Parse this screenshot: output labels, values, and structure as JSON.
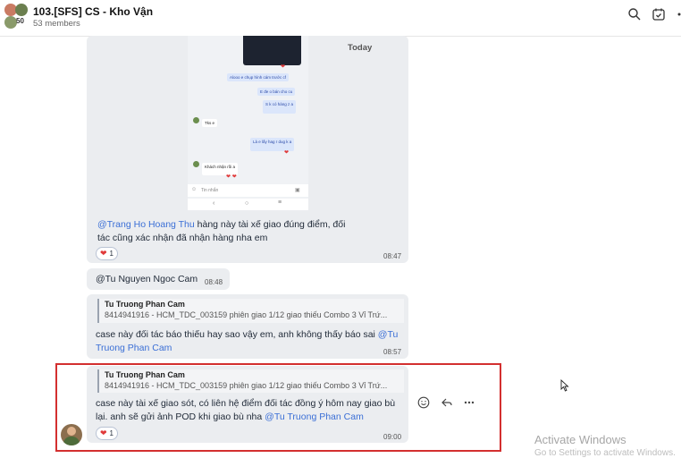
{
  "header": {
    "group_name": "103.[SFS] CS - Kho Vận",
    "member_count": "53 members",
    "avatar_count": "50"
  },
  "date_divider": "Today",
  "screenshot": {
    "messages_right": [
      "Alooo e chụp hình cám trước cf",
      "E đe o bán cho cu",
      "S k có hàng z a",
      "Là e lấy hag r dug k a"
    ],
    "messages_left": [
      "Tks e",
      "Khách nhận rồi a"
    ],
    "input_placeholder": "Tin nhắn"
  },
  "messages": [
    {
      "mention": "@Trang Ho Hoang Thu",
      "text_line1": " hàng này tài xế giao đúng điểm, đối",
      "text_line2": "tác cũng xác nhận đã nhận hàng nha em",
      "reaction_count": "1",
      "time": "08:47"
    },
    {
      "mention": "@Tu Nguyen Ngoc Cam",
      "time": "08:48"
    },
    {
      "quote_name": "Tu Truong Phan Cam",
      "quote_text": "8414941916 - HCM_TDC_003159 phiên giao 1/12 giao thiếu Combo 3 Vỉ Trứ...",
      "text_line1": "case này đối tác báo thiếu hay sao vậy em, anh không thấy báo sai ",
      "mention_a": "@Tu",
      "mention_b": "Truong Phan Cam",
      "time": "08:57"
    },
    {
      "quote_name": "Tu Truong Phan Cam",
      "quote_text": "8414941916 - HCM_TDC_003159 phiên giao 1/12 giao thiếu Combo 3 Vỉ Trứ...",
      "text_line1": "case này tài xế giao sót, có liên hệ điểm đối tác đồng ý hôm nay giao bù",
      "text_line2": "lại. anh sẽ gửi ảnh POD khi giao bù nha ",
      "mention": "@Tu Truong Phan Cam",
      "reaction_count": "1",
      "time": "09:00"
    }
  ],
  "watermark": {
    "line1": "Activate Windows",
    "line2": "Go to Settings to activate Windows."
  }
}
